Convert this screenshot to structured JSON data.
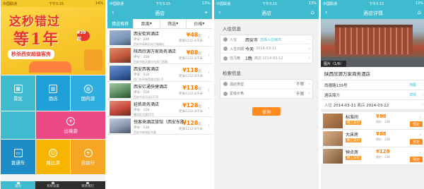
{
  "phone1": {
    "status": {
      "carrier": "中国联通",
      "time": "下午3:15",
      "battery": "14%"
    },
    "banner": {
      "line1": "这秒错过",
      "line2": "等1年",
      "price_badge": "¥39起",
      "tag": "秒杀西安超值客房",
      "colors": {
        "banner": "#f7c52a",
        "title": "#e7362f"
      }
    },
    "tiles": [
      {
        "id": "scenic",
        "label": "景区",
        "icon": "scenic-icon",
        "color": "#3fbbd0"
      },
      {
        "id": "hotel",
        "label": "酒店",
        "icon": "hotel-icon",
        "color": "#1f9fd8"
      },
      {
        "id": "domestic",
        "label": "国内游",
        "icon": "globe-icon",
        "color": "#2eaee0"
      },
      {
        "id": "outbound",
        "label": "出境游",
        "icon": "airplane-icon",
        "color": "#ec4a84"
      },
      {
        "id": "bus",
        "label": "直通车",
        "icon": "bus-icon",
        "color": "#1e8cc6"
      },
      {
        "id": "around",
        "label": "周边游",
        "icon": "around-icon",
        "color": "#f5b500"
      },
      {
        "id": "selfdrive",
        "label": "自由行",
        "icon": "selfdrive-icon",
        "color": "#f6a623"
      }
    ],
    "bottom_tabs": [
      {
        "label": "首页",
        "active": true
      },
      {
        "label": "系统设置",
        "active": false
      },
      {
        "label": "联系我们",
        "active": false
      }
    ]
  },
  "phone2": {
    "status": {
      "carrier": "中国联通",
      "time": "下午3:15",
      "battery": "13%"
    },
    "title": "酒店",
    "filters": [
      {
        "label": "猜送推荐",
        "selected": true
      },
      {
        "label": "距离",
        "selected": false
      },
      {
        "label": "筛选",
        "selected": false
      },
      {
        "label": "价格",
        "selected": false
      }
    ],
    "hotels": [
      {
        "name": "西安街宾酒店",
        "score": "评分：298",
        "addr": "西安市高新区电子城路近",
        "price": "48",
        "unit": "起",
        "dist": "距离1232.8千米"
      },
      {
        "name": "陕西欣源万家商务酒店",
        "score": "评分：358",
        "addr": "西安市航天路与东直门西路",
        "price": "88",
        "unit": "起",
        "dist": "距离1232.8千米"
      },
      {
        "name": "西安西客酒店",
        "score": "评分：518",
        "addr": "西门外环城西路北段1号",
        "price": "118",
        "unit": "起",
        "dist": "距离1232.8千米"
      },
      {
        "name": "西安亿通快捷酒店",
        "score": "评分：118",
        "addr": "西安市长乐坊157号",
        "price": "118",
        "unit": "起",
        "dist": "距离1232.8千米"
      },
      {
        "name": "延炼商务酒店",
        "score": "评分：128",
        "addr": "雁塔区北路55号",
        "price": "128",
        "unit": "起",
        "dist": "距离1232.8千米"
      },
      {
        "name": "悦客来酒店旅馆（西安东路）",
        "score": "评分：128",
        "addr": "西安市新城区东路",
        "price": "128",
        "unit": "起",
        "dist": "距离1232.8千米"
      }
    ],
    "thumb_colors": [
      "#7a95b8",
      "#c55b3e",
      "#3f66a8",
      "#5d8f63",
      "#c64a3a",
      "#8a98b0"
    ]
  },
  "phone3": {
    "status": {
      "carrier": "中国联通",
      "time": "下午3:15",
      "battery": "13%"
    },
    "title": "酒店",
    "section1": "入住信息",
    "rows1": [
      {
        "label": "入住",
        "value": "西安市",
        "sub": "选择入住城市"
      },
      {
        "label": "入住日期",
        "value": "今天",
        "sub": "2014-03-11"
      },
      {
        "label": "住几晚",
        "value": "1晚",
        "sub": "离店 2014-03-12"
      }
    ],
    "section2": "检索信息",
    "rows2": [
      {
        "label": "酒店类型",
        "value": "不限"
      },
      {
        "label": "星级价格",
        "value": "不限"
      }
    ],
    "search_button": "查询"
  },
  "phone4": {
    "status": {
      "carrier": "中国联通",
      "time": "下午3:15",
      "battery": "13%"
    },
    "title": "酒店详情",
    "photo_count": "图片（1/6）",
    "hotel_name": "陕西欣源万家商务酒店",
    "address": "尚德路139号",
    "address_link": "地图",
    "intro": "酒店简介",
    "intro_link": "详情",
    "checkin": "入住",
    "checkin_date": "2014-03-11",
    "checkout": "离店",
    "checkout_date": "2014-03-12",
    "rooms": [
      {
        "name": "标准间",
        "tag": "晚上支付",
        "price": "88",
        "sub": "原价：338",
        "book": "预定"
      },
      {
        "name": "大床房",
        "tag": "晚上支付",
        "price": "88",
        "sub": "原价：338",
        "book": "预定"
      },
      {
        "name": "钟点房",
        "tag": "晚上支付",
        "price": "128",
        "sub": "原价：338",
        "book": "预定"
      }
    ]
  }
}
